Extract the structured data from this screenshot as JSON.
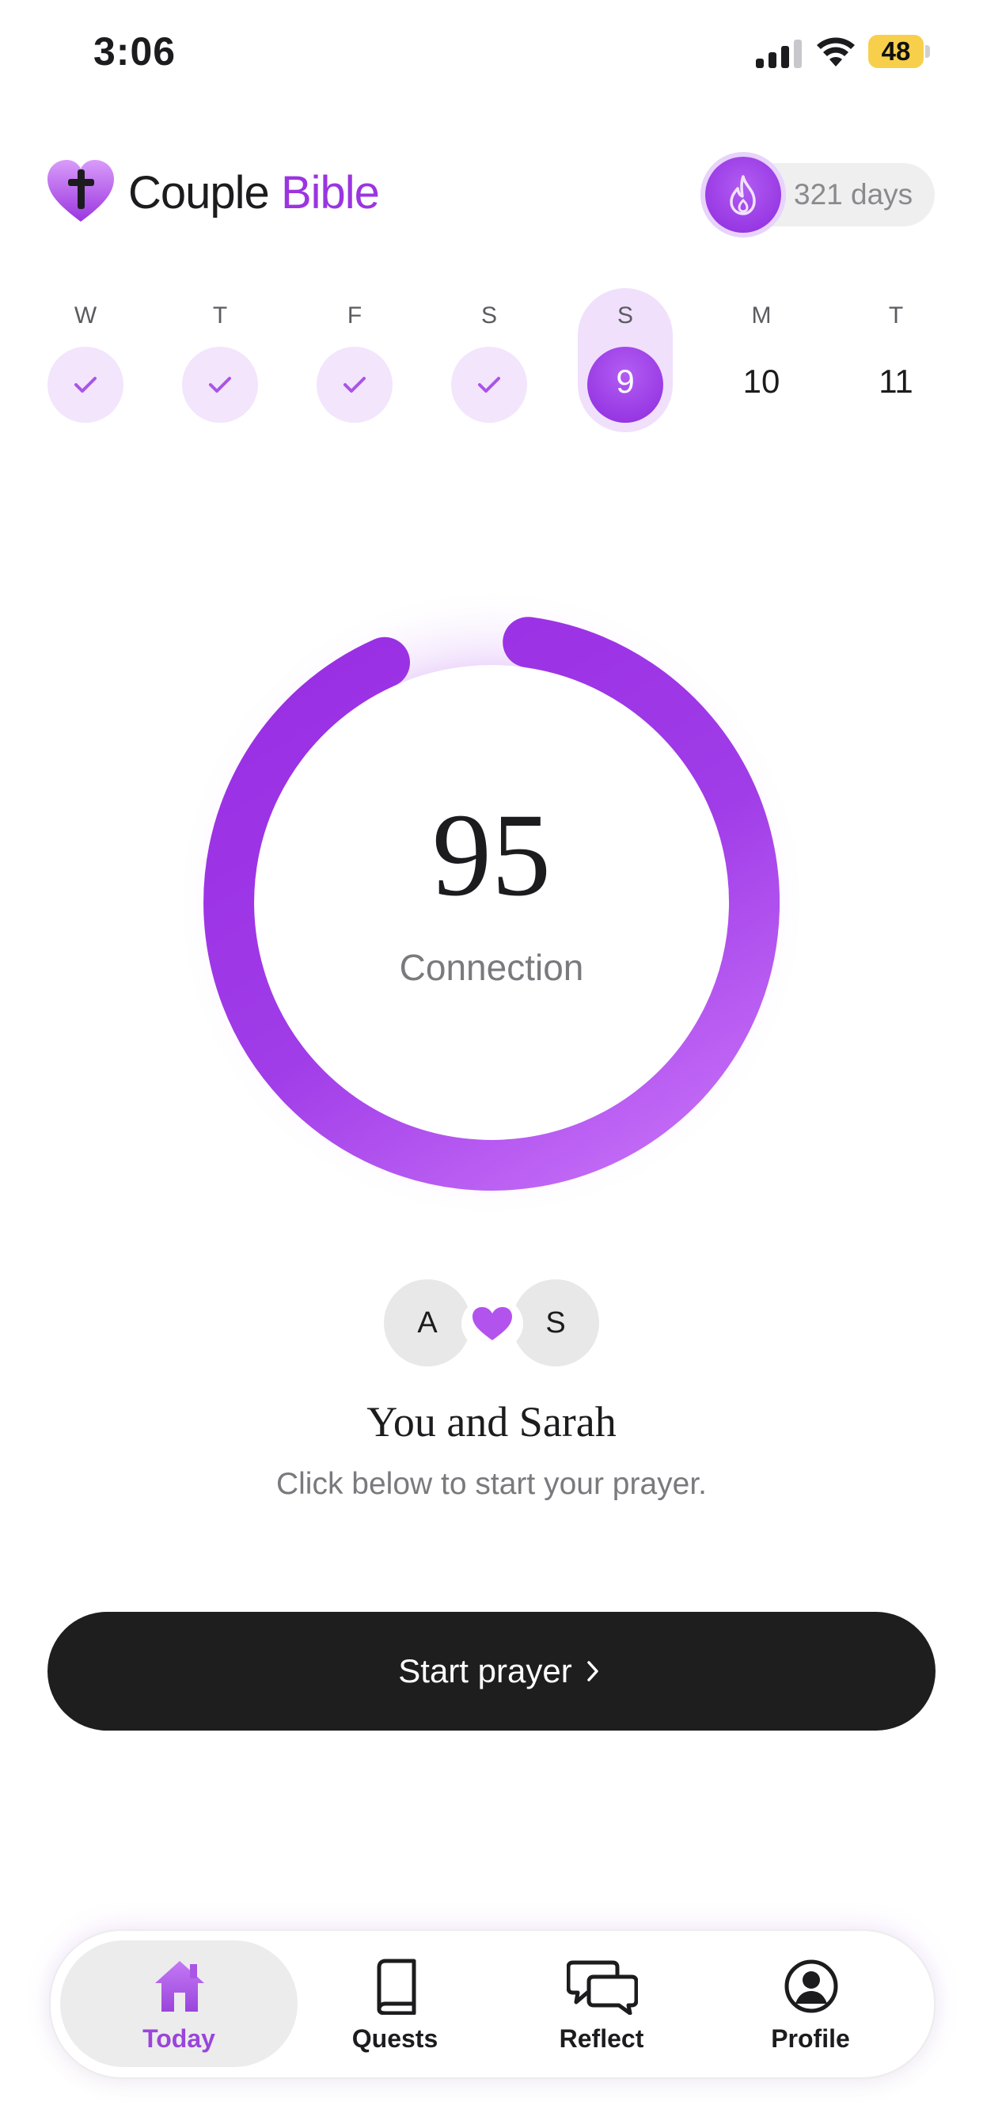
{
  "status_bar": {
    "time": "3:06",
    "battery_level": "48",
    "icons": [
      "cellular-signal-icon",
      "wifi-icon",
      "battery-icon"
    ]
  },
  "header": {
    "title_part1": "Couple",
    "title_part2": "Bible",
    "logo_icon": "heart-cross-icon",
    "streak_icon": "flame-icon",
    "streak_text": "321 days"
  },
  "week": [
    {
      "letter": "W",
      "state": "done",
      "icon": "check-icon"
    },
    {
      "letter": "T",
      "state": "done",
      "icon": "check-icon"
    },
    {
      "letter": "F",
      "state": "done",
      "icon": "check-icon"
    },
    {
      "letter": "S",
      "state": "done",
      "icon": "check-icon"
    },
    {
      "letter": "S",
      "state": "current",
      "number": "9"
    },
    {
      "letter": "M",
      "state": "upcoming",
      "number": "10"
    },
    {
      "letter": "T",
      "state": "upcoming",
      "number": "11"
    }
  ],
  "connection": {
    "score": "95",
    "label": "Connection",
    "progress_percent": 95
  },
  "couple": {
    "avatar_left": "A",
    "avatar_right": "S",
    "heart_icon": "heart-icon",
    "title": "You and Sarah",
    "subtitle": "Click below to start your prayer."
  },
  "start_button": {
    "label": "Start prayer",
    "icon": "chevron-right-icon"
  },
  "tabs": [
    {
      "label": "Today",
      "icon": "home-icon",
      "active": true
    },
    {
      "label": "Quests",
      "icon": "book-icon",
      "active": false
    },
    {
      "label": "Reflect",
      "icon": "chat-bubbles-icon",
      "active": false
    },
    {
      "label": "Profile",
      "icon": "profile-icon",
      "active": false
    }
  ],
  "colors": {
    "accent": "#9a35e0",
    "accent_light": "#f2e5fc",
    "button_dark": "#1e1e1e",
    "ring_start": "#9a2fe4",
    "ring_end": "#c36bf6"
  }
}
